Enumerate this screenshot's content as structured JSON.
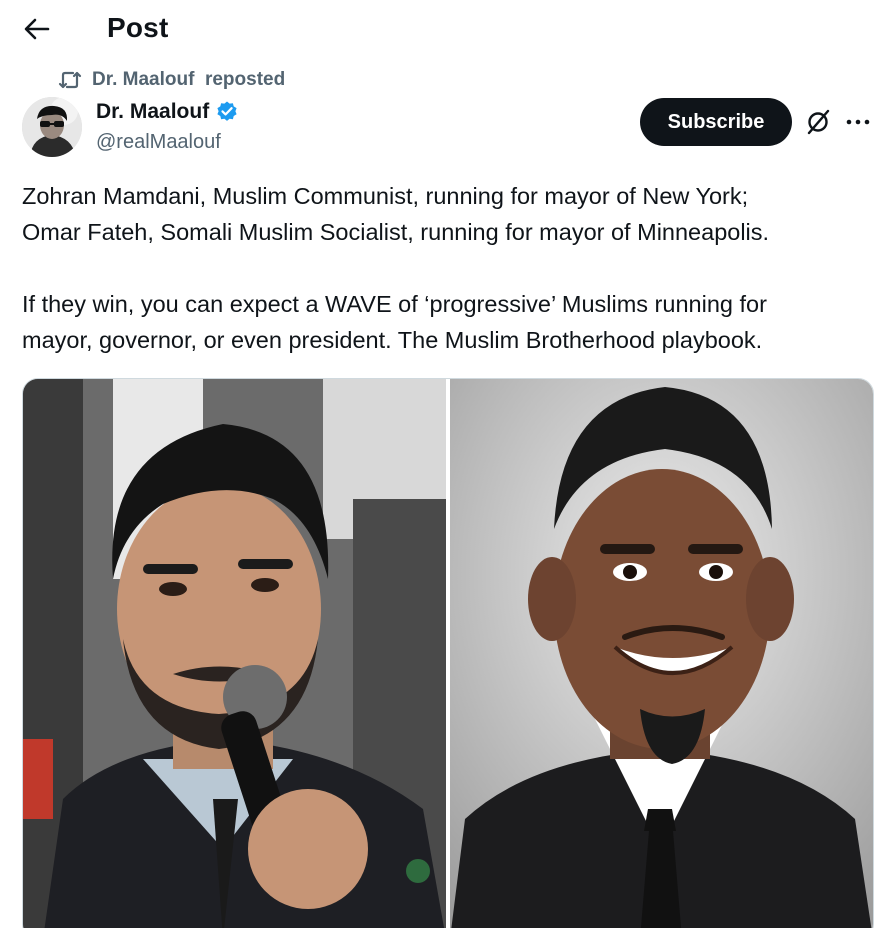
{
  "header": {
    "title": "Post"
  },
  "repost": {
    "label": "Dr. Maalouf  reposted"
  },
  "author": {
    "name": "Dr. Maalouf",
    "handle": "@realMaalouf",
    "verified": true
  },
  "actions": {
    "subscribe_label": "Subscribe"
  },
  "post": {
    "paragraph_1_line_1": "Zohran Mamdani, Muslim Communist, running for mayor of New York;",
    "paragraph_1_line_2": "Omar Fateh, Somali Muslim Socialist, running for mayor of Minneapolis.",
    "paragraph_2_line_1": "If they win, you can expect a WAVE of ‘progressive’ Muslims running for",
    "paragraph_2_line_2": "mayor, governor, or even president. The Muslim Brotherhood playbook."
  },
  "colors": {
    "text": "#0f1419",
    "secondary": "#536471",
    "verified": "#1d9bf0",
    "button_bg": "#0f1419"
  },
  "icons": {
    "back": "arrow-left-icon",
    "repost": "repost-icon",
    "verified": "verified-badge-icon",
    "grok": "grok-icon",
    "more": "more-icon"
  }
}
